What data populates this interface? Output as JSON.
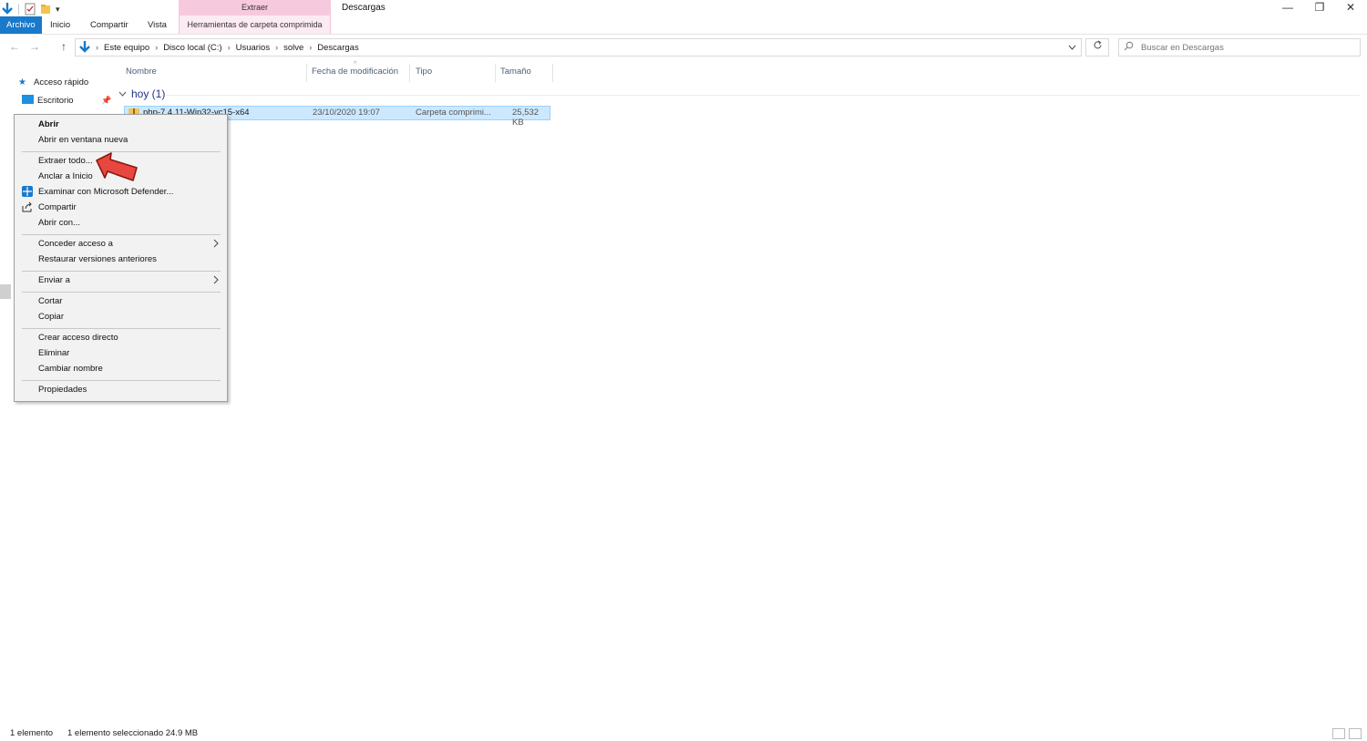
{
  "window": {
    "title": "Descargas",
    "minimize_glyph": "—",
    "maximize_glyph": "❐",
    "close_glyph": "✕"
  },
  "ribbon": {
    "tabs": [
      "Archivo",
      "Inicio",
      "Compartir",
      "Vista"
    ],
    "contextual_group": "Extraer",
    "contextual_tab": "Herramientas de carpeta comprimida",
    "qat_dropdown": "▾",
    "accent_color": "#1979ca",
    "contextual_color": "#f7c9dd"
  },
  "address": {
    "crumbs": [
      "Este equipo",
      "Disco local (C:)",
      "Usuarios",
      "solve",
      "Descargas"
    ],
    "separator": "›",
    "search_placeholder": "Buscar en Descargas"
  },
  "nav": {
    "back": "←",
    "forward": "→",
    "up": "↑",
    "quick_access": "Acceso rápido",
    "desktop": "Escritorio"
  },
  "columns": {
    "name": "Nombre",
    "modified": "Fecha de modificación",
    "type": "Tipo",
    "size": "Tamaño"
  },
  "group": {
    "label": "hoy (1)"
  },
  "file": {
    "name": "php-7.4.11-Win32-vc15-x64",
    "modified": "23/10/2020 19:07",
    "type": "Carpeta comprimi...",
    "size": "25,532 KB"
  },
  "context_menu": {
    "open": "Abrir",
    "open_new_window": "Abrir en ventana nueva",
    "extract_all": "Extraer todo...",
    "pin_start": "Anclar a Inicio",
    "defender": "Examinar con Microsoft Defender...",
    "share": "Compartir",
    "open_with": "Abrir con...",
    "give_access": "Conceder acceso a",
    "restore_versions": "Restaurar versiones anteriores",
    "send_to": "Enviar a",
    "cut": "Cortar",
    "copy": "Copiar",
    "create_shortcut": "Crear acceso directo",
    "delete": "Eliminar",
    "rename": "Cambiar nombre",
    "properties": "Propiedades"
  },
  "status": {
    "count": "1 elemento",
    "selected": "1 elemento seleccionado  24.9 MB"
  }
}
